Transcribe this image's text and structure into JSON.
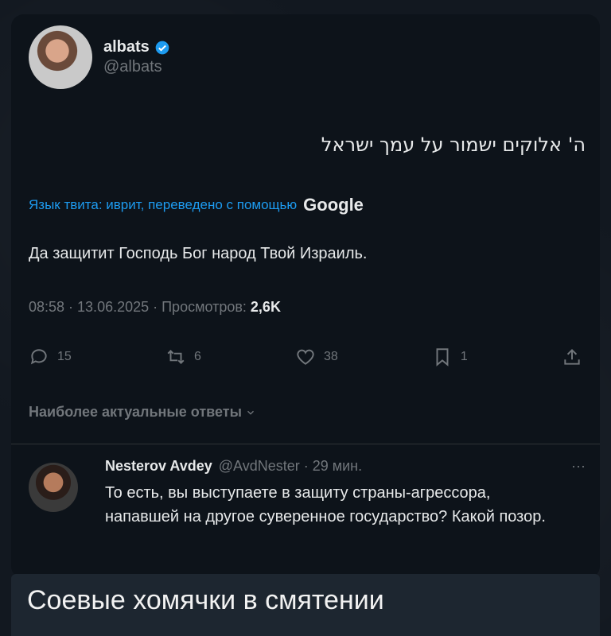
{
  "tweet": {
    "display_name": "albats",
    "handle": "@albats",
    "text": "ה' אלוקים ישמור על עמך ישראל",
    "translate_label": "Язык твита: иврит, переведено с помощью",
    "google_label": "Google",
    "translation": "Да защитит Господь Бог народ Твой Израиль.",
    "timestamp": "08:58 · 13.06.2025 · Просмотров:",
    "views": "2,6K"
  },
  "actions": {
    "replies": "15",
    "retweets": "6",
    "likes": "38",
    "bookmarks": "1"
  },
  "sort_label": "Наиболее актуальные ответы",
  "reply": {
    "name": "Nesterov Avdey",
    "handle": "@AvdNester · 29 мин.",
    "more": "···",
    "text": "То есть, вы выступаете в защиту страны-агрессора, напавшей на другое суверенное государство? Какой позор."
  },
  "caption": "Соевые хомячки в смятении",
  "colors": {
    "accent": "#1d9bf0",
    "muted": "#71767b",
    "text": "#e7e9ea",
    "card_bg": "#0d131a"
  }
}
